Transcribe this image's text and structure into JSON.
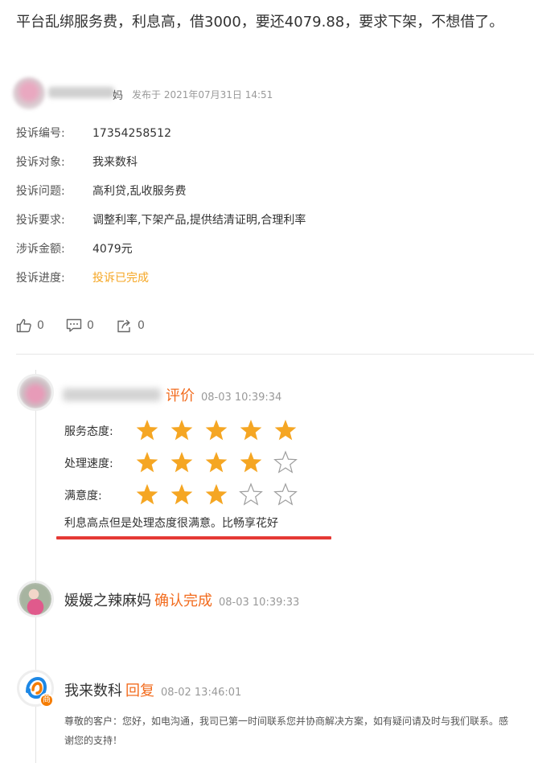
{
  "complaint": {
    "title": "平台乱绑服务费，利息高，借3000，要还4079.88，要求下架，不想借了。",
    "author_suffix": "妈",
    "post_time": "发布于 2021年07月31日 14:51",
    "fields": [
      {
        "key": "投诉编号:",
        "value": "17354258512"
      },
      {
        "key": "投诉对象:",
        "value": "我来数科"
      },
      {
        "key": "投诉问题:",
        "value": "高利贷,乱收服务费"
      },
      {
        "key": "投诉要求:",
        "value": "调整利率,下架产品,提供结清证明,合理利率"
      },
      {
        "key": "涉诉金额:",
        "value": "4079元"
      },
      {
        "key": "投诉进度:",
        "value": "投诉已完成"
      }
    ],
    "actions": {
      "like_count": "0",
      "comment_count": "0",
      "share_count": "0"
    }
  },
  "timeline": {
    "review": {
      "action": "评价",
      "time": "08-03 10:39:34",
      "ratings": [
        {
          "label": "服务态度:",
          "stars": 5,
          "max": 5
        },
        {
          "label": "处理速度:",
          "stars": 4,
          "max": 5
        },
        {
          "label": "满意度:",
          "stars": 3,
          "max": 5
        }
      ],
      "text": "利息高点但是处理态度很满意。比畅享花好"
    },
    "confirm": {
      "name": "媛媛之辣麻妈",
      "action": "确认完成",
      "time": "08-03 10:39:33"
    },
    "reply": {
      "name": "我来数科",
      "action": "回复",
      "time": "08-02 13:46:01",
      "badge": "商",
      "text": "尊敬的客户：您好，如电沟通，我司已第一时间联系您并协商解决方案，如有疑问请及时与我们联系。感谢您的支持！"
    }
  },
  "colors": {
    "orange": "#f26b1d",
    "progress": "#f5a623",
    "star": "#f5a623",
    "underline": "#e53935"
  }
}
